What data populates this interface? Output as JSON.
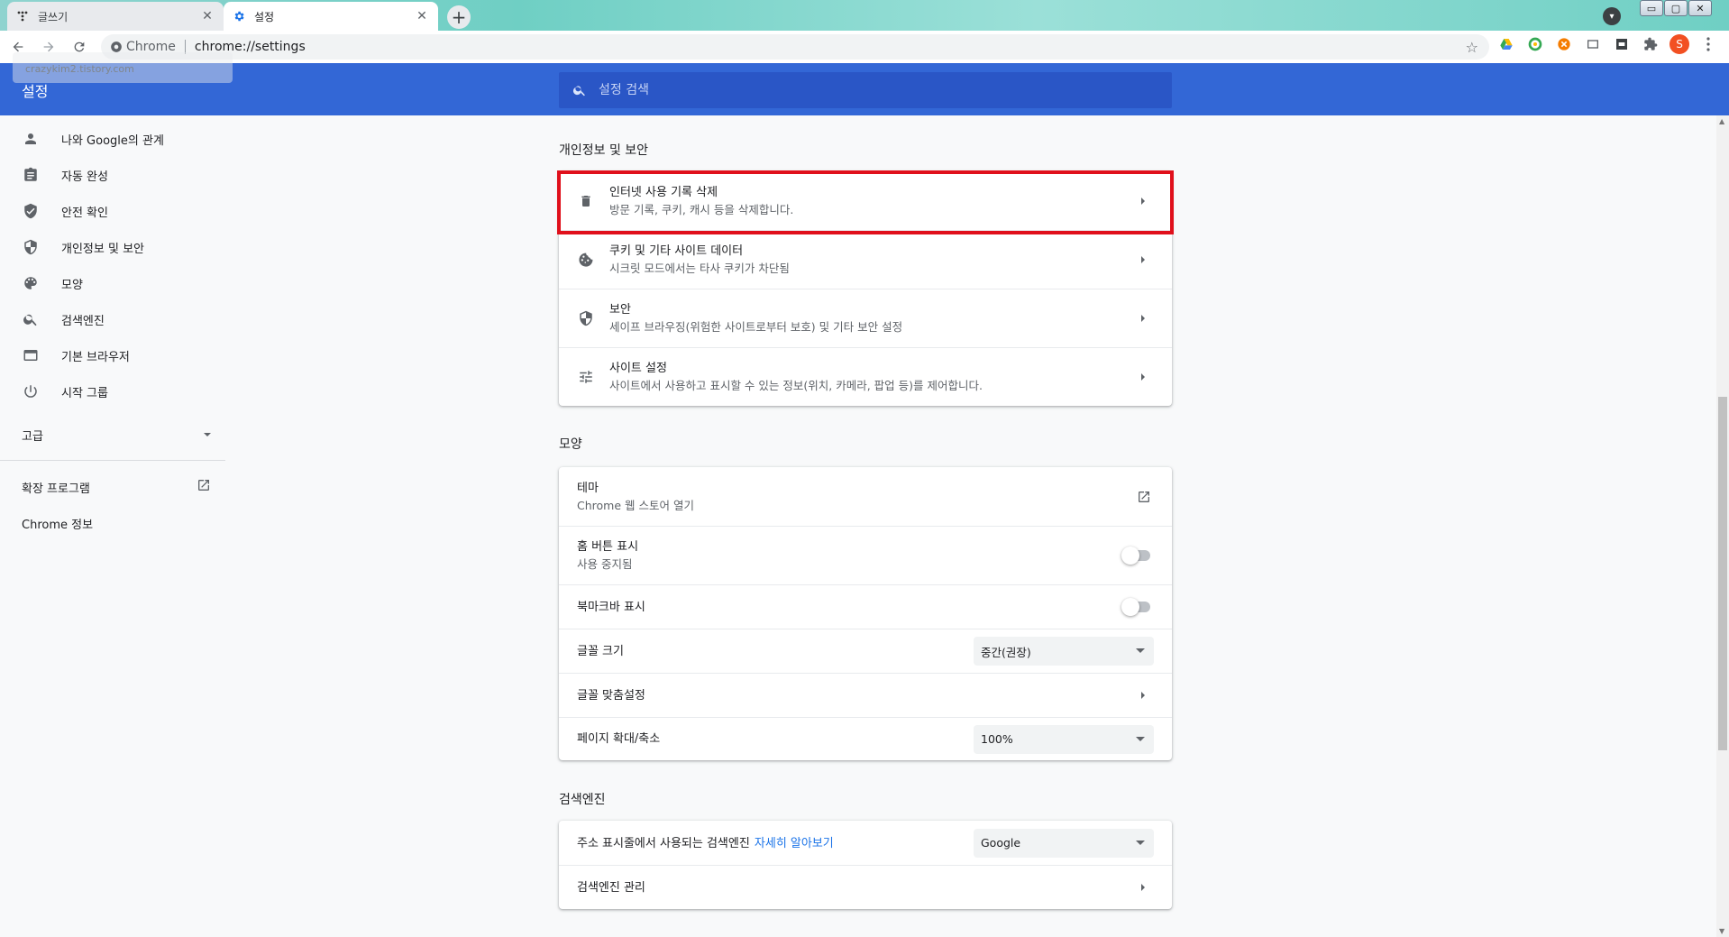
{
  "tabs": [
    {
      "title": "글쓰기",
      "close": "✕"
    },
    {
      "title": "설정",
      "close": "✕"
    }
  ],
  "new_tab": "+",
  "omnibox": {
    "site": "Chrome",
    "url": "chrome://settings"
  },
  "tooltip": "crazykim2.tistory.com",
  "profile_initial": "S",
  "header": {
    "title": "설정",
    "search_placeholder": "설정 검색"
  },
  "sidebar": {
    "items": [
      {
        "label": "나와 Google의 관계",
        "icon": "person-icon"
      },
      {
        "label": "자동 완성",
        "icon": "clipboard-icon"
      },
      {
        "label": "안전 확인",
        "icon": "shield-check-icon"
      },
      {
        "label": "개인정보 및 보안",
        "icon": "shield-icon"
      },
      {
        "label": "모양",
        "icon": "palette-icon"
      },
      {
        "label": "검색엔진",
        "icon": "search-icon"
      },
      {
        "label": "기본 브라우저",
        "icon": "browser-icon"
      },
      {
        "label": "시작 그룹",
        "icon": "power-icon"
      }
    ],
    "advanced": "고급",
    "extensions": "확장 프로그램",
    "about": "Chrome 정보"
  },
  "privacy": {
    "title": "개인정보 및 보안",
    "rows": [
      {
        "title": "인터넷 사용 기록 삭제",
        "sub": "방문 기록, 쿠키, 캐시 등을 삭제합니다.",
        "icon": "trash-icon"
      },
      {
        "title": "쿠키 및 기타 사이트 데이터",
        "sub": "시크릿 모드에서는 타사 쿠키가 차단됨",
        "icon": "cookie-icon"
      },
      {
        "title": "보안",
        "sub": "세이프 브라우징(위험한 사이트로부터 보호) 및 기타 보안 설정",
        "icon": "shield-icon"
      },
      {
        "title": "사이트 설정",
        "sub": "사이트에서 사용하고 표시할 수 있는 정보(위치, 카메라, 팝업 등)를 제어합니다.",
        "icon": "tune-icon"
      }
    ]
  },
  "appearance": {
    "title": "모양",
    "theme": {
      "title": "테마",
      "sub": "Chrome 웹 스토어 열기"
    },
    "home_button": {
      "title": "홈 버튼 표시",
      "sub": "사용 중지됨",
      "enabled": false
    },
    "bookmarks_bar": {
      "title": "북마크바 표시",
      "enabled": false
    },
    "font_size": {
      "title": "글꼴 크기",
      "value": "중간(권장)"
    },
    "customize_fonts": {
      "title": "글꼴 맞춤설정"
    },
    "page_zoom": {
      "title": "페이지 확대/축소",
      "value": "100%"
    }
  },
  "search_engine": {
    "title": "검색엔진",
    "default": {
      "title": "주소 표시줄에서 사용되는 검색엔진",
      "link": "자세히 알아보기",
      "value": "Google"
    },
    "manage": {
      "title": "검색엔진 관리"
    }
  },
  "colors": {
    "header": "#3367d6",
    "highlight": "#e0101b",
    "link": "#1a73e8"
  }
}
